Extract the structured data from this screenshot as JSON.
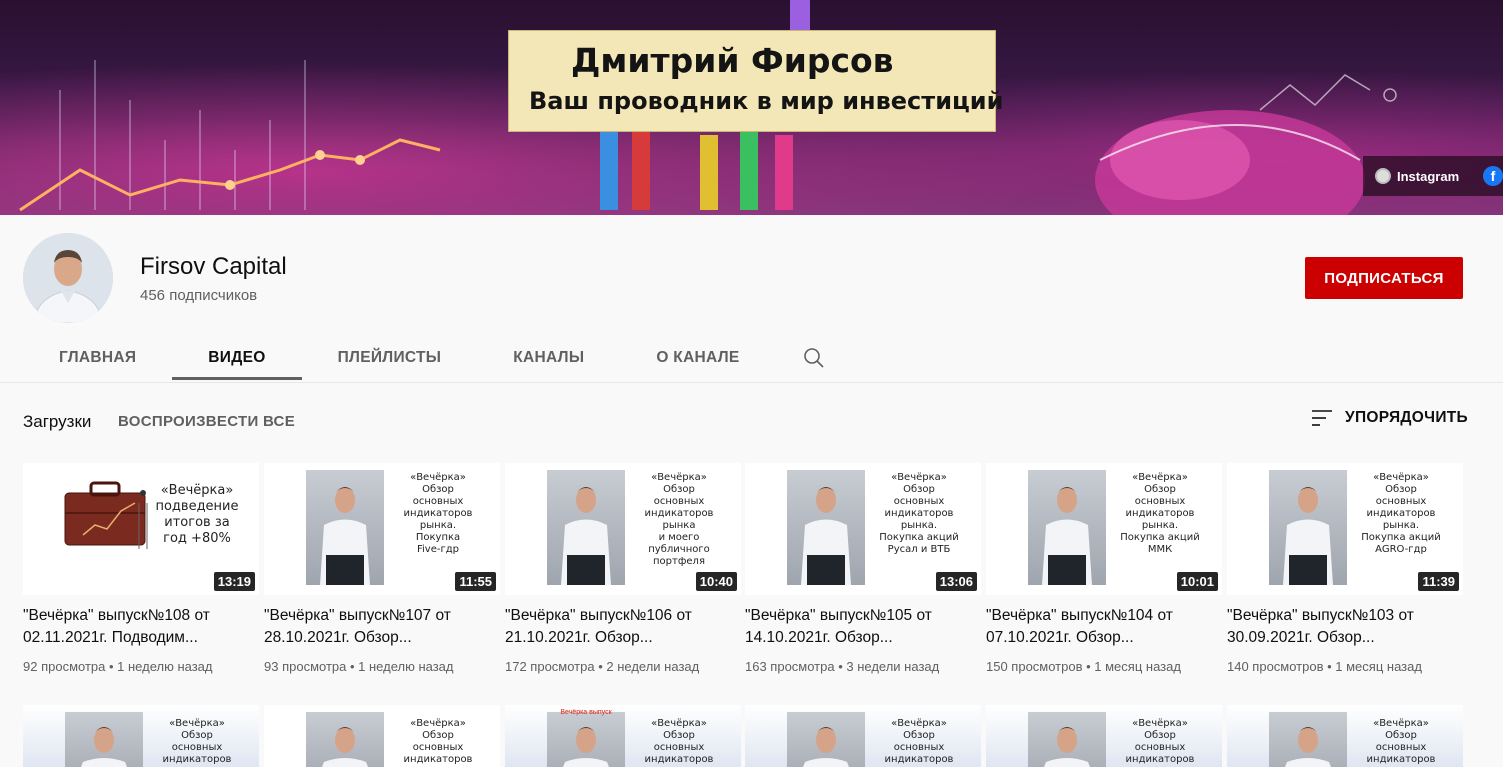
{
  "banner": {
    "name": "Дмитрий Фирсов",
    "tagline": "Ваш проводник в мир инвестиций",
    "links": [
      {
        "label": "Instagram",
        "icon": "globe-icon"
      },
      {
        "label": "",
        "icon": "facebook-icon"
      }
    ]
  },
  "channel": {
    "name": "Firsov Capital",
    "subscribers": "456 подписчиков",
    "subscribe_label": "ПОДПИСАТЬСЯ"
  },
  "tabs": [
    {
      "label": "ГЛАВНАЯ",
      "active": false
    },
    {
      "label": "ВИДЕО",
      "active": true
    },
    {
      "label": "ПЛЕЙЛИСТЫ",
      "active": false
    },
    {
      "label": "КАНАЛЫ",
      "active": false
    },
    {
      "label": "О КАНАЛЕ",
      "active": false
    }
  ],
  "section": {
    "title": "Загрузки",
    "play_all": "ВОСПРОИЗВЕСТИ ВСЕ",
    "sort_label": "УПОРЯДОЧИТЬ"
  },
  "videos": [
    {
      "thumb_text": "«Вечёрка»\nподведение\nитогов за\nгод +80%",
      "duration": "13:19",
      "title": "\"Вечёрка\" выпуск№108 от 02.11.2021г. Подводим...",
      "meta": "92 просмотра • 1 неделю назад"
    },
    {
      "thumb_text": "«Вечёрка»\nОбзор\nосновных\nиндикаторов\nрынка.\nПокупка\nFive-гдр",
      "duration": "11:55",
      "title": "\"Вечёрка\" выпуск№107 от 28.10.2021г. Обзор...",
      "meta": "93 просмотра • 1 неделю назад"
    },
    {
      "thumb_text": "«Вечёрка»\nОбзор\nосновных\nиндикаторов\nрынка\nи моего\nпубличного\nпортфеля",
      "duration": "10:40",
      "title": "\"Вечёрка\" выпуск№106 от 21.10.2021г. Обзор...",
      "meta": "172 просмотра • 2 недели назад"
    },
    {
      "thumb_text": "«Вечёрка»\nОбзор\nосновных\nиндикаторов\nрынка.\nПокупка акций\nРусал и ВТБ",
      "duration": "13:06",
      "title": "\"Вечёрка\" выпуск№105 от 14.10.2021г. Обзор...",
      "meta": "163 просмотра • 3 недели назад"
    },
    {
      "thumb_text": "«Вечёрка»\nОбзор\nосновных\nиндикаторов\nрынка.\nПокупка акций\nММК",
      "duration": "10:01",
      "title": "\"Вечёрка\" выпуск№104 от 07.10.2021г. Обзор...",
      "meta": "150 просмотров • 1 месяц назад"
    },
    {
      "thumb_text": "«Вечёрка»\nОбзор\nосновных\nиндикаторов\nрынка.\nПокупка акций\nAGRO-гдр",
      "duration": "11:39",
      "title": "\"Вечёрка\" выпуск№103 от 30.09.2021г. Обзор...",
      "meta": "140 просмотров • 1 месяц назад"
    }
  ],
  "videos_row2": [
    {
      "thumb_text": "«Вечёрка»\nОбзор\nосновных\nиндикаторов"
    },
    {
      "thumb_text": "«Вечёрка»\nОбзор\nосновных\nиндикаторов"
    },
    {
      "thumb_text": "«Вечёрка»\nОбзор\nосновных\nиндикаторов",
      "red_label": "Вечёрка выпуск"
    },
    {
      "thumb_text": "«Вечёрка»\nОбзор\nосновных\nиндикаторов"
    },
    {
      "thumb_text": "«Вечёрка»\nОбзор\nосновных\nиндикаторов"
    },
    {
      "thumb_text": "«Вечёрка»\nОбзор\nосновных\nиндикаторов"
    }
  ],
  "colors": {
    "subscribe": "#cc0000",
    "background": "#f9f9f9",
    "text_secondary": "#606060"
  }
}
